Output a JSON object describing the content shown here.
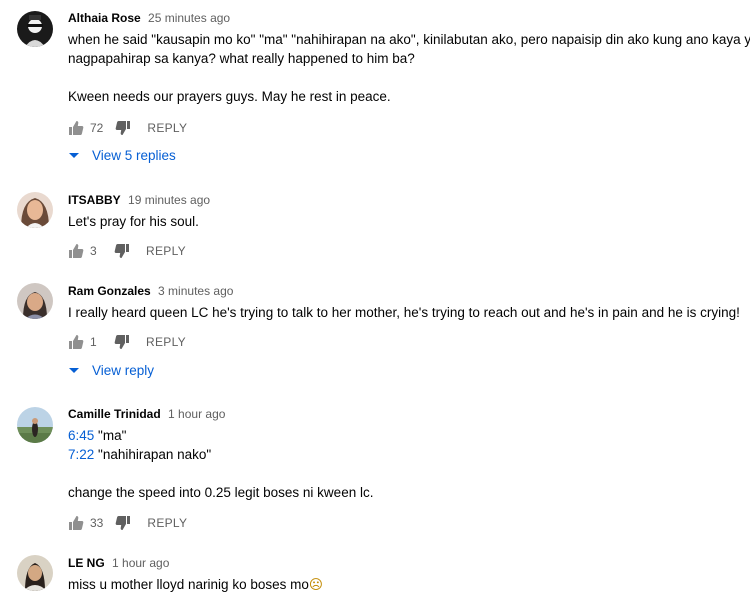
{
  "comments": [
    {
      "author": "Althaia Rose",
      "time": "25 minutes ago",
      "lines": [
        "when he said \"kausapin mo ko\" \"ma\" \"nahihirapan na ako\", kinilabutan ako, pero napaisip din ako kung ano kaya yung",
        "nagpapahirap sa kanya? what really happened to him ba?",
        "",
        "Kween needs our prayers guys. May he rest in peace."
      ],
      "likes": "72",
      "reply_label": "REPLY",
      "replies_label": "View 5 replies"
    },
    {
      "author": "ITSABBY",
      "time": "19 minutes ago",
      "lines": [
        "Let's pray for his soul."
      ],
      "likes": "3",
      "reply_label": "REPLY"
    },
    {
      "author": "Ram Gonzales",
      "time": "3 minutes ago",
      "lines": [
        "I really heard queen LC he's trying to talk to her mother, he's trying to reach out and he's in pain and he is crying!"
      ],
      "likes": "1",
      "reply_label": "REPLY",
      "replies_label": "View reply"
    },
    {
      "author": "Camille Trinidad",
      "time": "1 hour ago",
      "ts1": "6:45",
      "ts1_text": " \"ma\"",
      "ts2": "7:22",
      "ts2_text": " \"nahihirapan nako\"",
      "line3": "change the speed into 0.25 legit boses ni kween lc.",
      "likes": "33",
      "reply_label": "REPLY"
    },
    {
      "author": "LE NG",
      "time": "1 hour ago",
      "text": "miss u mother lloyd narinig ko boses mo",
      "emoji": "☹"
    }
  ],
  "icons": {
    "like": "thumbs-up-icon",
    "dislike": "thumbs-down-icon",
    "expand": "caret-down-icon"
  },
  "colors": {
    "link": "#065fd4",
    "secondary_text": "#606060",
    "primary_text": "#030303"
  }
}
